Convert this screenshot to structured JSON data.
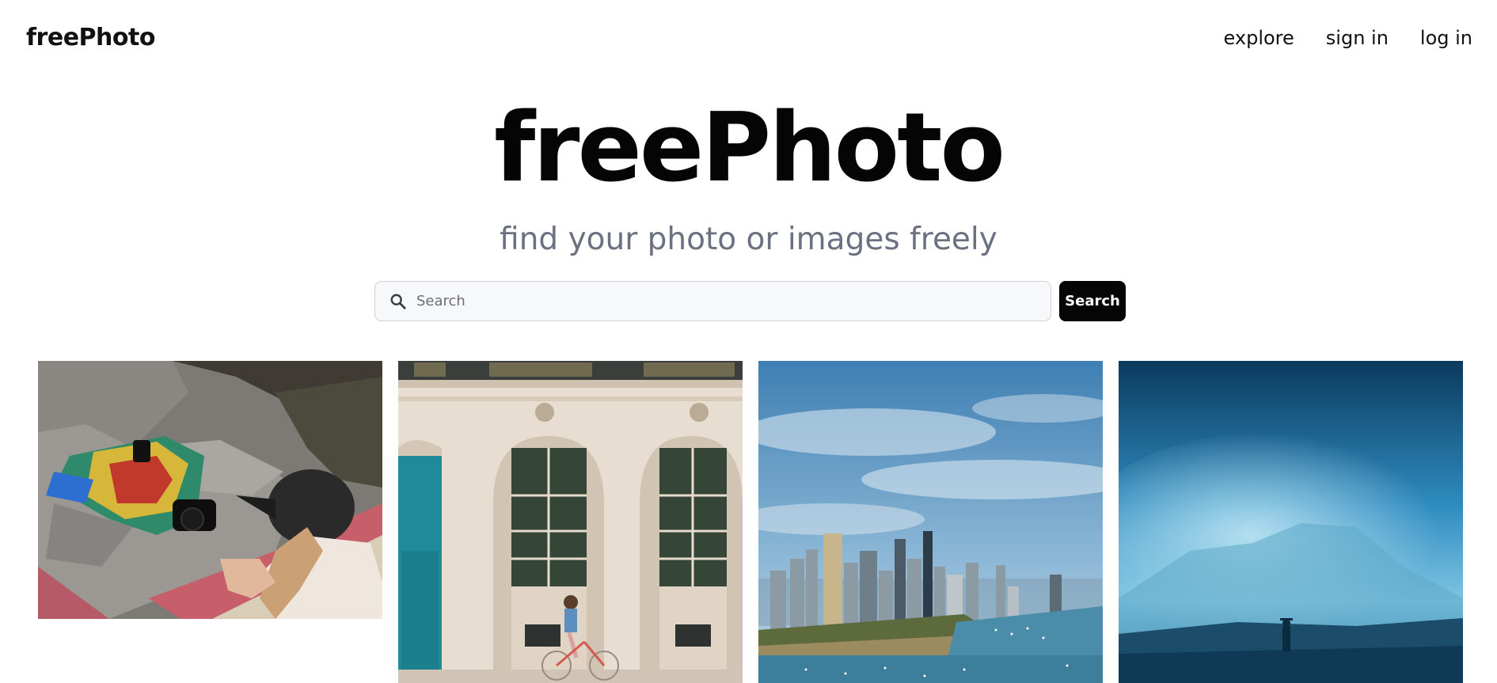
{
  "navbar": {
    "brand": "freePhoto",
    "links": [
      "explore",
      "sign in",
      "log in"
    ]
  },
  "hero": {
    "title": "freePhoto",
    "subtitle": "find your photo or images freely"
  },
  "search": {
    "placeholder": "Search",
    "value": "",
    "button_label": "Search",
    "icon": "search-icon"
  },
  "gallery": {
    "photos": [
      {
        "subject": "person with camera on rocks"
      },
      {
        "subject": "building facade with cyclist"
      },
      {
        "subject": "aerial city skyline by the lake"
      },
      {
        "subject": "silhouette in blue misty mountains"
      }
    ]
  }
}
